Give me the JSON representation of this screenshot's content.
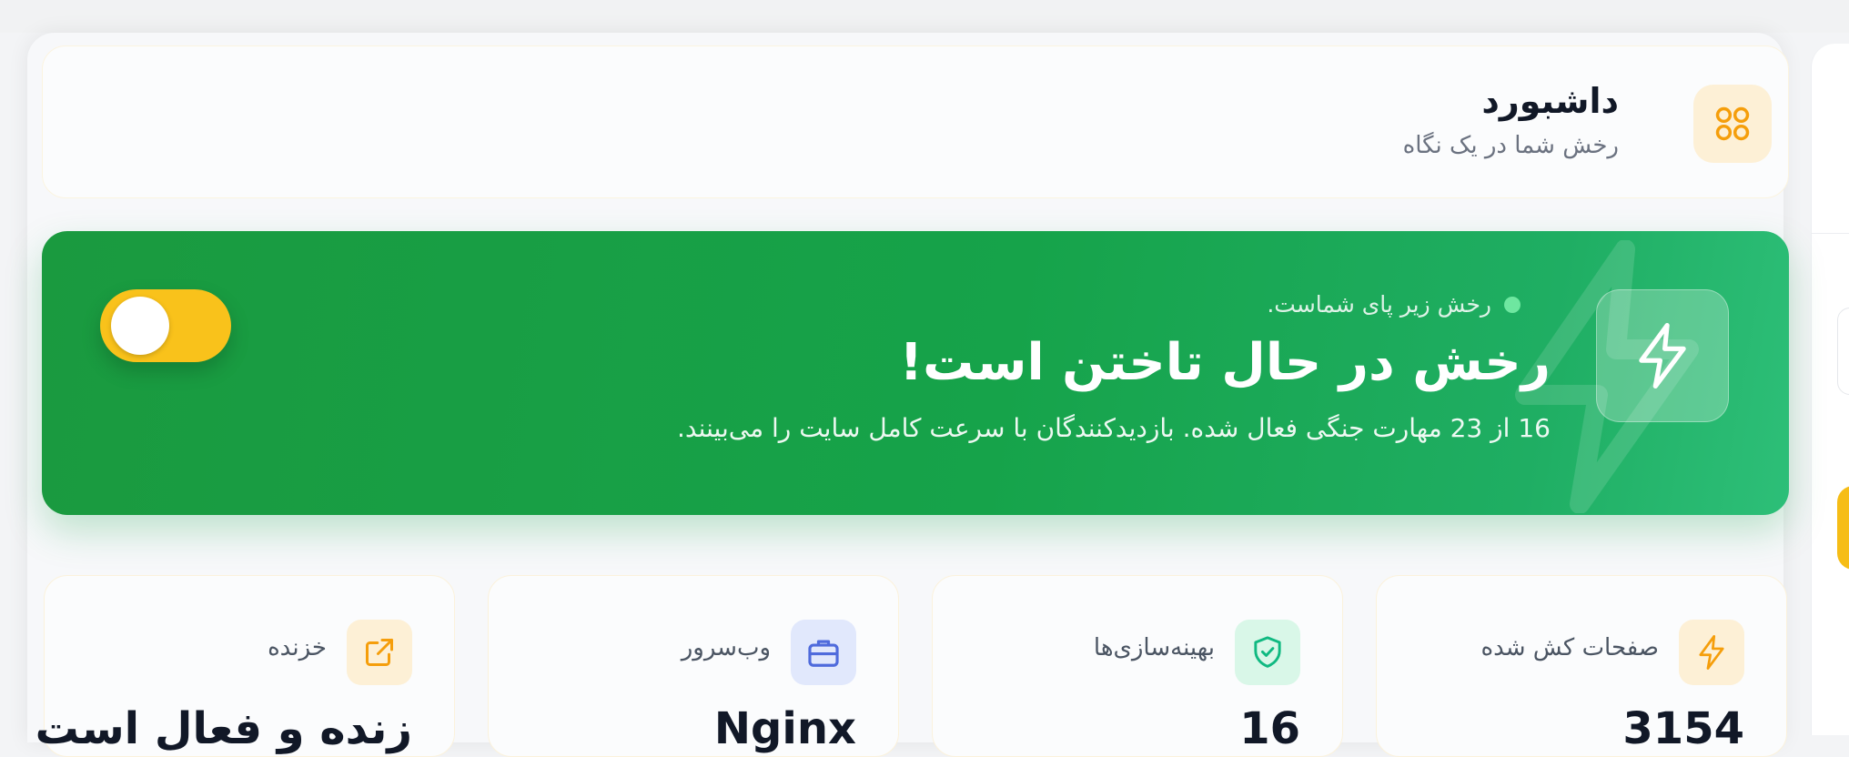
{
  "header": {
    "title": "داشبورد",
    "subtitle": "رخش شما در یک نگاه",
    "icon": "apps-grid-icon"
  },
  "banner": {
    "status": "رخش زیر پای شماست.",
    "title": "رخش در حال تاختن است!",
    "description": "16 از 23 مهارت جنگی فعال شده. بازدیدکنندگان با سرعت کامل سایت را می‌بینند.",
    "icon": "lightning-icon",
    "toggle_on": true
  },
  "cards": [
    {
      "label": "صفحات کش شده",
      "value": "3154",
      "icon": "lightning-icon",
      "accent": "#f59e0b",
      "bg": "#fdf0d6"
    },
    {
      "label": "بهینه‌سازی‌ها",
      "value": "16",
      "icon": "shield-check-icon",
      "accent": "#10b981",
      "bg": "#d9f7e8"
    },
    {
      "label": "وب‌سرور",
      "value": "Nginx",
      "icon": "briefcase-icon",
      "accent": "#4f6bdc",
      "bg": "#e1e8fc"
    },
    {
      "label": "خزنده",
      "value": "زنده و فعال است",
      "icon": "external-link-icon",
      "accent": "#f59e0b",
      "bg": "#fdf0d6"
    }
  ],
  "colors": {
    "banner_green": "#16a34a",
    "toggle_yellow": "#f9c21b"
  }
}
